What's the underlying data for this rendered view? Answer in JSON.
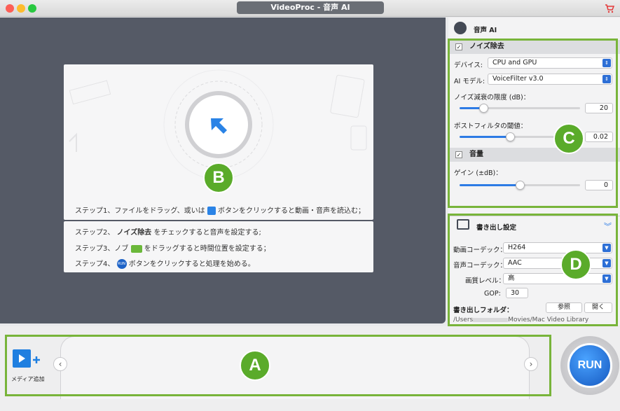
{
  "window": {
    "title": "VideoProc - 音声 AI"
  },
  "preview": {
    "step1_prefix": "ステップ1、ファイルをドラッグ、或いは",
    "step1_suffix": "ボタンをクリックすると動画・音声を読込む；",
    "step2_prefix": "ステップ2、",
    "step2_bold": "ノイズ除去",
    "step2_suffix": "をチェックすると音声を設定する;",
    "step3_prefix": "ステップ3、ノブ",
    "step3_suffix": "をドラッグすると時間位置を設定する；",
    "step4_prefix": "ステップ4、",
    "step4_icon_text": "RUN",
    "step4_suffix": "ボタンをクリックすると処理を始める。"
  },
  "panel": {
    "title": "音声 AI",
    "noise": {
      "label": "ノイズ除去",
      "checked": true,
      "device_label": "デバイス:",
      "device_value": "CPU and GPU",
      "model_label": "AI モデル:",
      "model_value": "VoiceFilter v3.0",
      "reduction_label": "ノイズ減衰の限度 (dB)：",
      "reduction_value": "20",
      "reduction_level": 0.2,
      "postfilter_label": "ポストフィルタの閾値：",
      "postfilter_value": "0.02",
      "postfilter_level": 0.42
    },
    "volume": {
      "label": "音量",
      "checked": true,
      "gain_label": "ゲイン (±dB)：",
      "gain_value": "0",
      "gain_level": 0.5
    }
  },
  "export": {
    "title": "書き出し設定",
    "video_codec_label": "動画コーデック：",
    "video_codec_value": "H264",
    "audio_codec_label": "音声コーデック：",
    "audio_codec_value": "AAC",
    "quality_label": "画質レベル：",
    "quality_value": "高",
    "gop_label": "GOP:",
    "gop_value": "30",
    "folder_label": "書き出しフォルダ：",
    "browse_button": "参照",
    "open_button": "開く",
    "path_prefix": "/Users",
    "path_suffix": "Movies/Mac Video Library"
  },
  "media": {
    "add_label": "メディア追加",
    "prev": "‹",
    "next": "›"
  },
  "run_label": "RUN",
  "markers": {
    "a": "A",
    "b": "B",
    "c": "C",
    "d": "D"
  },
  "colors": {
    "accent": "#2d7be5",
    "marker_green": "#5aab2a",
    "marker_border": "#78b43a",
    "preview_bg": "#555a66"
  },
  "icons": [
    "cart-icon",
    "cursor-arrow-icon",
    "add-media-icon",
    "audio-ai-icon",
    "export-settings-icon",
    "run-icon"
  ]
}
